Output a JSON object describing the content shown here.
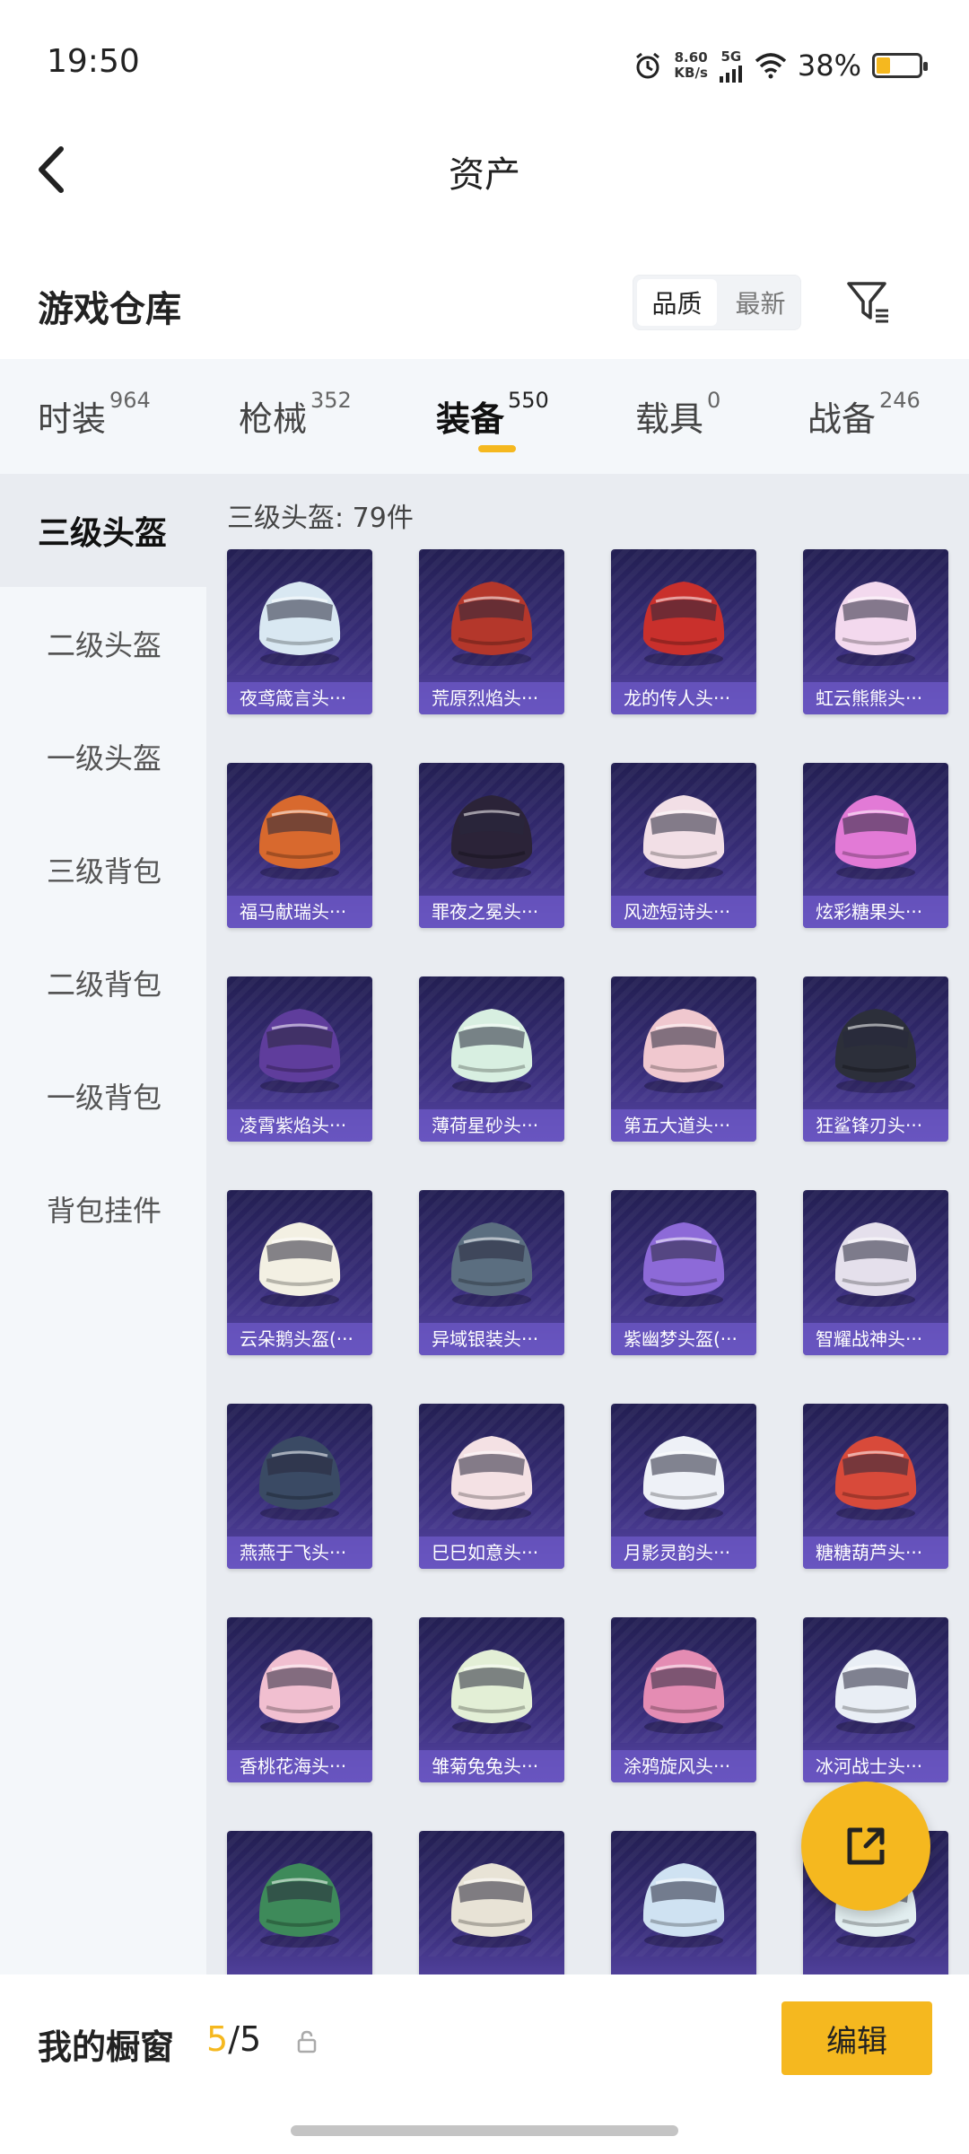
{
  "status_bar": {
    "time": "19:50",
    "net_speed_value": "8.60",
    "net_speed_unit": "KB/s",
    "signal_type": "5G",
    "battery_text": "38%",
    "battery_level": 0.38
  },
  "nav": {
    "title": "资产"
  },
  "section": {
    "title": "游戏仓库"
  },
  "sort": {
    "options": [
      "品质",
      "最新"
    ],
    "active": "品质"
  },
  "tabs": [
    {
      "label": "时装",
      "count": "964"
    },
    {
      "label": "枪械",
      "count": "352"
    },
    {
      "label": "装备",
      "count": "550"
    },
    {
      "label": "载具",
      "count": "0"
    },
    {
      "label": "战备",
      "count": "246"
    }
  ],
  "active_tab": "装备",
  "sidebar": {
    "items": [
      "三级头盔",
      "二级头盔",
      "一级头盔",
      "三级背包",
      "二级背包",
      "一级背包",
      "背包挂件"
    ],
    "active": "三级头盔"
  },
  "list_title": "三级头盔: 79件",
  "items": [
    {
      "name": "夜鸢箴言头···",
      "color": "#d9e8f2"
    },
    {
      "name": "荒原烈焰头···",
      "color": "#b4372b"
    },
    {
      "name": "龙的传人头···",
      "color": "#c9302c"
    },
    {
      "name": "虹云熊熊头···",
      "color": "#f3d9ee"
    },
    {
      "name": "福马献瑞头···",
      "color": "#d8692e"
    },
    {
      "name": "罪夜之冕头···",
      "color": "#2b2338"
    },
    {
      "name": "风迹短诗头···",
      "color": "#f2dfe6"
    },
    {
      "name": "炫彩糖果头···",
      "color": "#e27ad6"
    },
    {
      "name": "凌霄紫焰头···",
      "color": "#5f3d9c"
    },
    {
      "name": "薄荷星砂头···",
      "color": "#d8efe1"
    },
    {
      "name": "第五大道头···",
      "color": "#f0c8cf"
    },
    {
      "name": "狂鲨锋刃头···",
      "color": "#2c2f3a"
    },
    {
      "name": "云朵鹅头盔(···",
      "color": "#f3f0e3"
    },
    {
      "name": "异域银装头···",
      "color": "#5b6e80"
    },
    {
      "name": "紫幽梦头盔(···",
      "color": "#8d6ad8"
    },
    {
      "name": "智耀战神头···",
      "color": "#e5e0ec"
    },
    {
      "name": "燕燕于飞头···",
      "color": "#3a4a64"
    },
    {
      "name": "巳巳如意头···",
      "color": "#f4e1e4"
    },
    {
      "name": "月影灵韵头···",
      "color": "#eef1f7"
    },
    {
      "name": "糖糖葫芦头···",
      "color": "#d84a3a"
    },
    {
      "name": "香桃花海头···",
      "color": "#f1bfd0"
    },
    {
      "name": "雏菊兔兔头···",
      "color": "#e3efd6"
    },
    {
      "name": "涂鸦旋风头···",
      "color": "#e48cb3"
    },
    {
      "name": "冰河战士头···",
      "color": "#e9eef5"
    },
    {
      "name": "",
      "color": "#3e8a5a"
    },
    {
      "name": "",
      "color": "#e8e3d6"
    },
    {
      "name": "",
      "color": "#cfe2f2"
    },
    {
      "name": "",
      "color": "#e2eef0"
    }
  ],
  "bottom_bar": {
    "showcase_label": "我的橱窗",
    "count_current": "5",
    "count_total": "/5",
    "edit_label": "编辑"
  },
  "colors": {
    "accent": "#f5b81f",
    "card_bg": "#2d2760",
    "sidebar_bg": "#f4f7fa"
  }
}
